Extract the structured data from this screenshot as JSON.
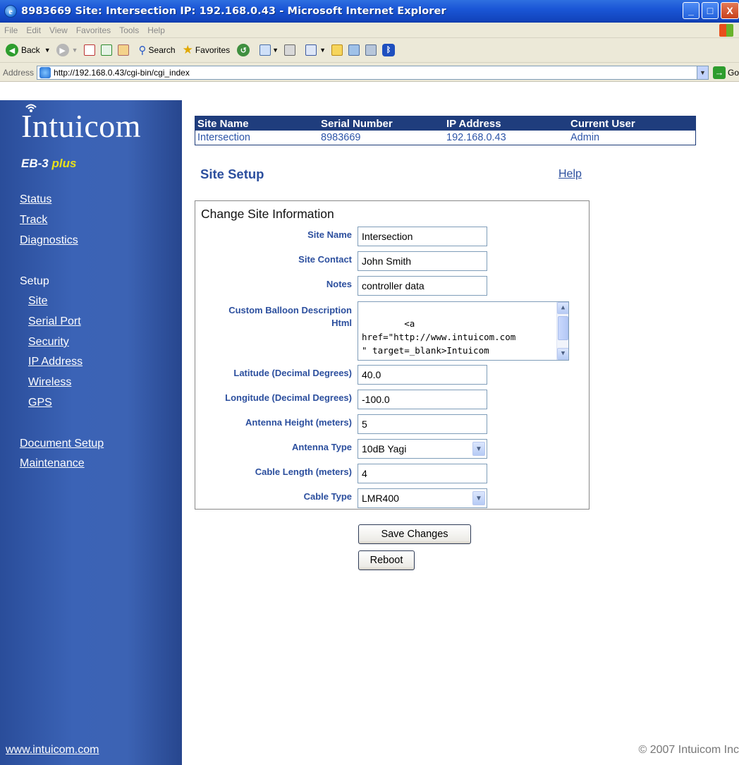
{
  "window": {
    "title": "8983669 Site: Intersection IP: 192.168.0.43 - Microsoft Internet Explorer",
    "minimize": "_",
    "maximize": "□",
    "close": "X"
  },
  "menubar": [
    "File",
    "Edit",
    "View",
    "Favorites",
    "Tools",
    "Help"
  ],
  "toolbar": {
    "back": "Back",
    "search": "Search",
    "favorites": "Favorites"
  },
  "address": {
    "label": "Address",
    "url": "http://192.168.0.43/cgi-bin/cgi_index",
    "go": "Go"
  },
  "sidebar": {
    "logo": "Intuicom",
    "model": "EB-3",
    "model_suffix": "plus",
    "status": "Status",
    "track": "Track",
    "diagnostics": "Diagnostics",
    "setup": "Setup",
    "site": "Site",
    "serial_port": "Serial Port",
    "security": "Security",
    "ip_address": "IP Address",
    "wireless": "Wireless",
    "gps": "GPS",
    "document_setup": "Document Setup",
    "maintenance": "Maintenance",
    "footer_link": "www.intuicom.com"
  },
  "info": {
    "headers": [
      "Site Name",
      "Serial Number",
      "IP Address",
      "Current User"
    ],
    "values": [
      "Intersection",
      "8983669",
      "192.168.0.43",
      "Admin"
    ]
  },
  "main": {
    "title": "Site Setup",
    "help": "Help",
    "form_heading": "Change Site Information"
  },
  "form": {
    "site_name_label": "Site Name",
    "site_name": "Intersection",
    "site_contact_label": "Site Contact",
    "site_contact": "John Smith",
    "notes_label": "Notes",
    "notes": "controller data",
    "balloon_label_1": "Custom Balloon Description",
    "balloon_label_2": "Html",
    "balloon_html": "<a\nhref=\"http://www.intuicom.com\n\" target=_blank>Intuicom\nHome Page</a>",
    "latitude_label": "Latitude (Decimal Degrees)",
    "latitude": "40.0",
    "longitude_label": "Longitude (Decimal Degrees)",
    "longitude": "-100.0",
    "antenna_height_label": "Antenna Height (meters)",
    "antenna_height": "5",
    "antenna_type_label": "Antenna Type",
    "antenna_type": "10dB Yagi",
    "cable_length_label": "Cable Length (meters)",
    "cable_length": "4",
    "cable_type_label": "Cable Type",
    "cable_type": "LMR400"
  },
  "buttons": {
    "save": "Save Changes",
    "reboot": "Reboot"
  },
  "copyright": "© 2007 Intuicom Inc"
}
